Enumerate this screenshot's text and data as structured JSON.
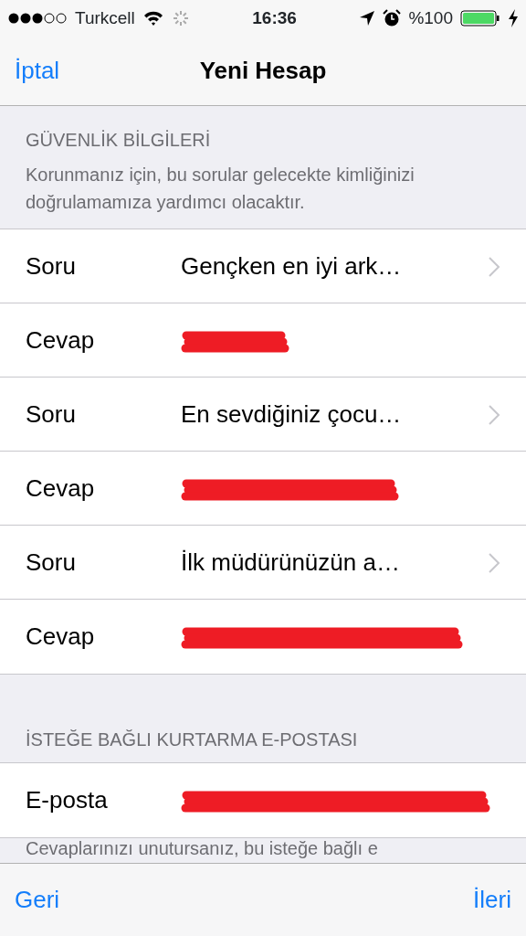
{
  "status_bar": {
    "carrier": "Turkcell",
    "time": "16:36",
    "battery": "%100"
  },
  "nav": {
    "cancel": "İptal",
    "title": "Yeni Hesap"
  },
  "sections": [
    {
      "header": "GÜVENLİK BİLGİLERİ",
      "description": "Korunmanız için, bu sorular gelecekte kimliğinizi doğrulamamıza yardımcı olacaktır.",
      "rows": [
        {
          "kind": "question",
          "label": "Soru",
          "value": "Gençken en iyi ark…"
        },
        {
          "kind": "answer",
          "label": "Cevap",
          "redacted": true
        },
        {
          "kind": "question",
          "label": "Soru",
          "value": "En sevdiğiniz çocu…"
        },
        {
          "kind": "answer",
          "label": "Cevap",
          "redacted": true
        },
        {
          "kind": "question",
          "label": "Soru",
          "value": "İlk müdürünüzün a…"
        },
        {
          "kind": "answer",
          "label": "Cevap",
          "redacted": true
        }
      ]
    },
    {
      "header": "İSTEĞE BAĞLI KURTARMA E-POSTASI",
      "rows": [
        {
          "kind": "answer",
          "label": "E-posta",
          "redacted": true
        }
      ],
      "footer": "Cevaplarınızı unutursanız, bu isteğe bağlı e"
    }
  ],
  "toolbar": {
    "back": "Geri",
    "next": "İleri"
  }
}
